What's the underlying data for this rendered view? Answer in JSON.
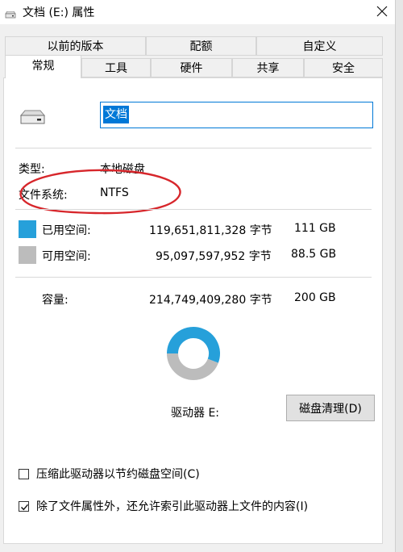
{
  "window": {
    "title": "文档 (E:) 属性",
    "close_icon": "close-icon"
  },
  "tabs_top": [
    "以前的版本",
    "配额",
    "自定义"
  ],
  "tabs_bottom": [
    "常规",
    "工具",
    "硬件",
    "共享",
    "安全"
  ],
  "active_tab": "常规",
  "drive_name": "文档",
  "info": {
    "type_label": "类型:",
    "type_value": "本地磁盘",
    "fs_label": "文件系统:",
    "fs_value": "NTFS"
  },
  "space": {
    "used_label": "已用空间:",
    "used_bytes": "119,651,811,328 字节",
    "used_size": "111 GB",
    "free_label": "可用空间:",
    "free_bytes": "95,097,597,952 字节",
    "free_size": "88.5 GB",
    "capacity_label": "容量:",
    "capacity_bytes": "214,749,409,280 字节",
    "capacity_size": "200 GB",
    "used_fraction": 0.557
  },
  "colors": {
    "used": "#26a0da",
    "free": "#bcbcbc",
    "annotation": "#d7262b",
    "accent": "#0078d7"
  },
  "drive_label": "驱动器 E:",
  "cleanup_button": "磁盘清理(D)",
  "options": {
    "compress_label": "压缩此驱动器以节约磁盘空间(C)",
    "compress_checked": false,
    "index_label": "除了文件属性外，还允许索引此驱动器上文件的内容(I)",
    "index_checked": true
  }
}
